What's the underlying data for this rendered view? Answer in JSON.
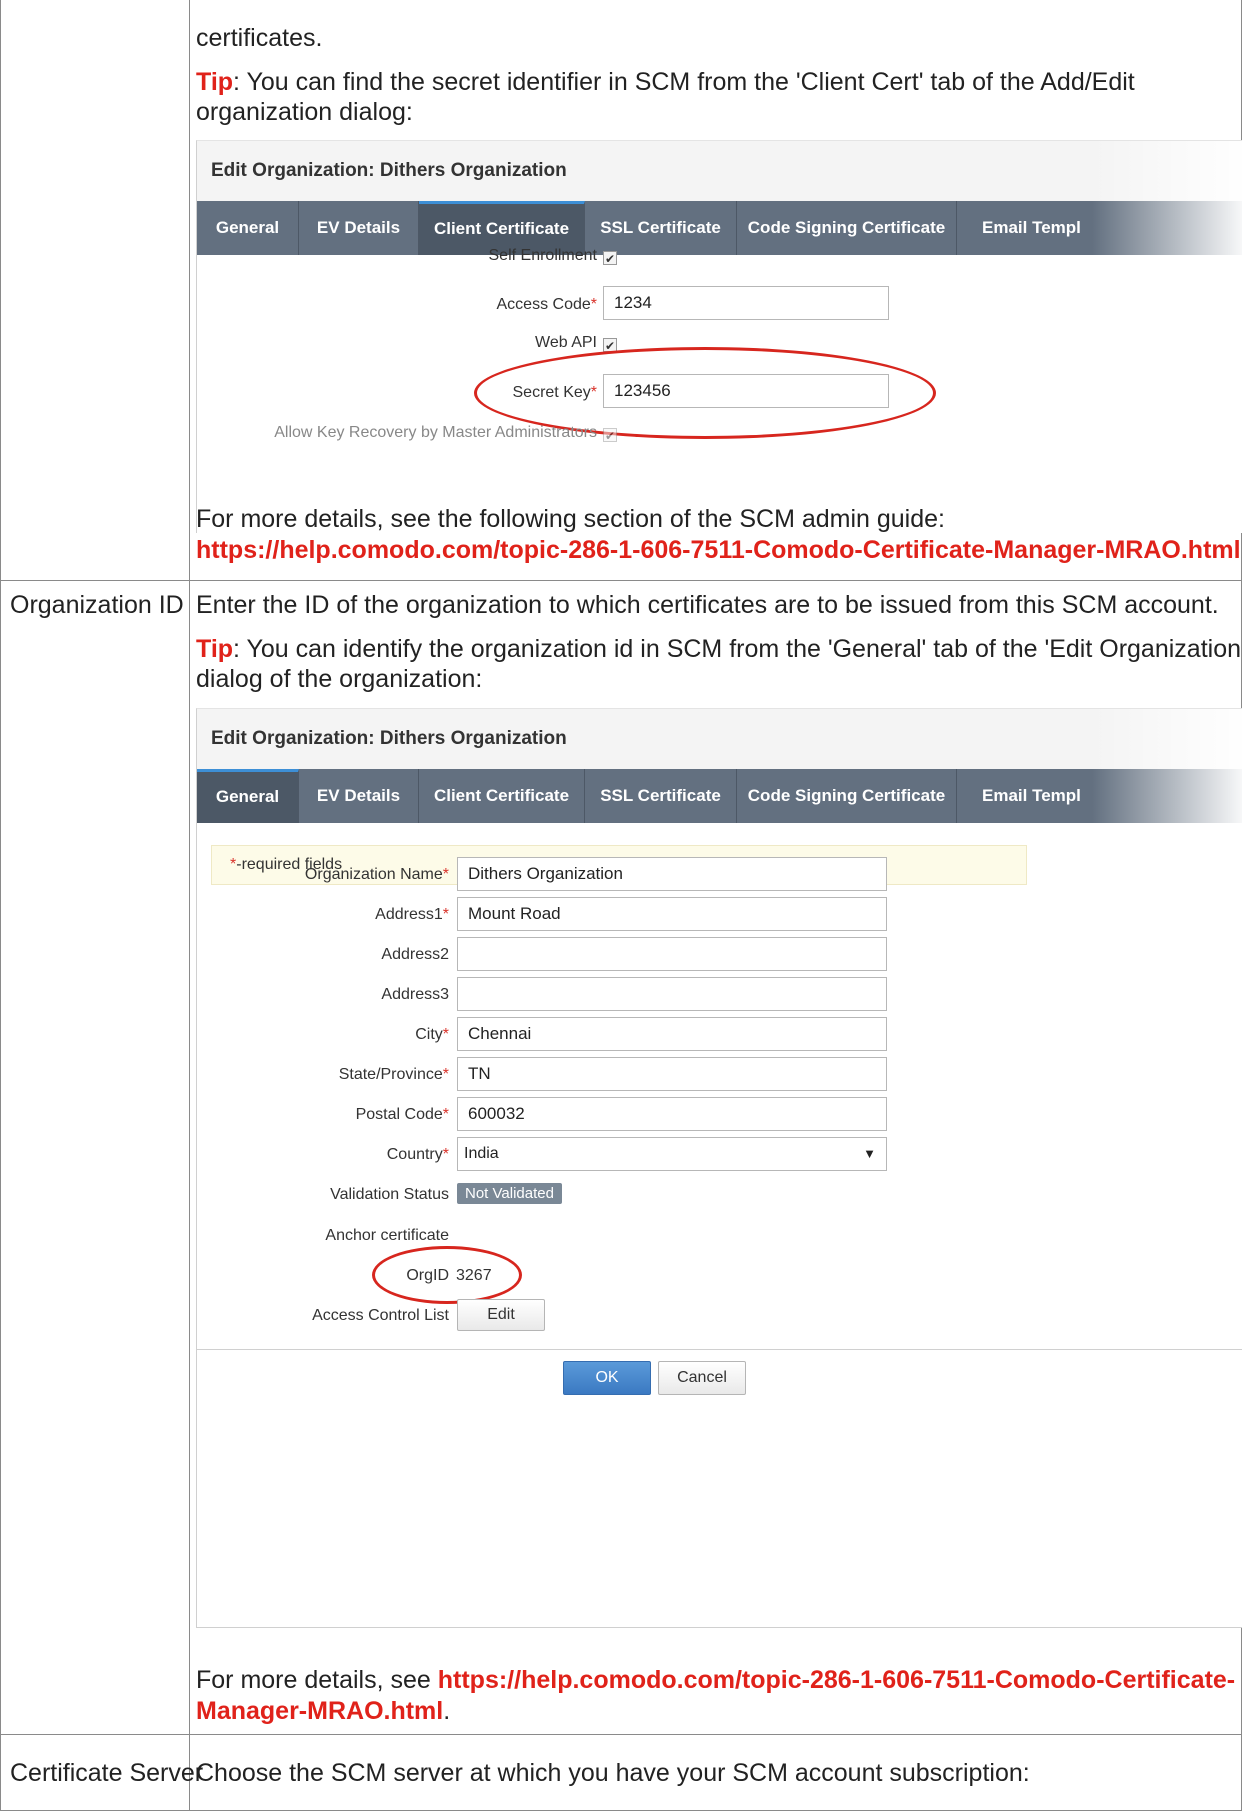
{
  "row1": {
    "text_top": "certificates.",
    "tip_label": "Tip",
    "tip_text_line1": ": You can find the secret identifier in SCM from the 'Client Cert' tab of the Add/Edit",
    "tip_text_line2": "organization dialog:",
    "details_text": "For more details, see the following section of the SCM admin guide:",
    "details_link": "https://help.comodo.com/topic-286-1-606-7511-Comodo-Certificate-Manager-MRAO.html",
    "details_end": "."
  },
  "dialog1": {
    "title": "Edit Organization: Dithers Organization",
    "tabs": [
      "General",
      "EV Details",
      "Client Certificate",
      "SSL Certificate",
      "Code Signing Certificate",
      "Email Templ"
    ],
    "active_tab": "Client Certificate",
    "self_enrollment_label": "Self Enrollment",
    "access_code_label": "Access Code",
    "access_code_value": "1234",
    "web_api_label": "Web API",
    "secret_key_label": "Secret Key",
    "secret_key_value": "123456",
    "key_recovery_label": "Allow Key Recovery by Master Administrators"
  },
  "row2": {
    "label": "Organization ID",
    "intro": "Enter the ID of the organization to which certificates are to be issued from this SCM account.",
    "tip_label": "Tip",
    "tip_text_line1": ": You can identify the organization id in SCM from the 'General' tab of the 'Edit Organization'",
    "tip_text_line2": "dialog of the organization:",
    "details_prefix": "For more details, see ",
    "details_link_line1": "https://help.comodo.com/topic-286-1-606-7511-Comodo-Certificate-",
    "details_link_line2": "Manager-MRAO.html",
    "details_end": "."
  },
  "dialog2": {
    "title": "Edit Organization: Dithers Organization",
    "tabs": [
      "General",
      "EV Details",
      "Client Certificate",
      "SSL Certificate",
      "Code Signing Certificate",
      "Email Templ"
    ],
    "active_tab": "General",
    "required_star": "*",
    "required_text": "-required fields",
    "fields": {
      "org_name_label": "Organization Name",
      "org_name_value": "Dithers Organization",
      "address1_label": "Address1",
      "address1_value": "Mount Road",
      "address2_label": "Address2",
      "address2_value": "",
      "address3_label": "Address3",
      "address3_value": "",
      "city_label": "City",
      "city_value": "Chennai",
      "state_label": "State/Province",
      "state_value": "TN",
      "postal_label": "Postal Code",
      "postal_value": "600032",
      "country_label": "Country",
      "country_value": "India",
      "validation_label": "Validation Status",
      "validation_value": "Not Validated",
      "anchor_label": "Anchor certificate",
      "orgid_label": "OrgID",
      "orgid_value": "3267",
      "acl_label": "Access Control List",
      "acl_button": "Edit"
    },
    "ok_button": "OK",
    "cancel_button": "Cancel"
  },
  "row3": {
    "label": "Certificate Server",
    "text": "Choose the SCM server at which you have your SCM account subscription:"
  },
  "colors": {
    "accent_red": "#e0221a",
    "tab_bar": "#637080",
    "primary_button": "#3b79c2"
  }
}
